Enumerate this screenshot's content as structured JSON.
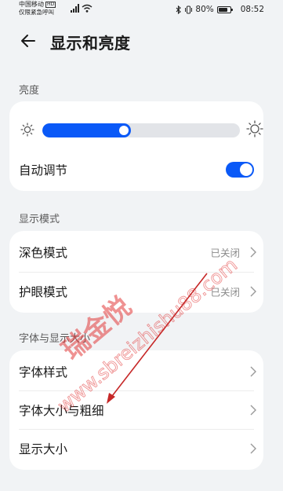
{
  "status_bar": {
    "carrier": "中国移动",
    "carrier_badge": "HD",
    "emergency": "仅限紧急呼叫",
    "battery": "80%",
    "battery_level": 0.8,
    "time": "08:52"
  },
  "header": {
    "title": "显示和亮度"
  },
  "brightness": {
    "section_label": "亮度",
    "level": 0.45,
    "auto_label": "自动调节",
    "auto_on": true
  },
  "display_mode": {
    "section_label": "显示模式",
    "items": [
      {
        "label": "深色模式",
        "value": "已关闭"
      },
      {
        "label": "护眼模式",
        "value": "已关闭"
      }
    ]
  },
  "font_display": {
    "section_label": "字体与显示大小",
    "items": [
      {
        "label": "字体样式"
      },
      {
        "label": "字体大小与粗细"
      },
      {
        "label": "显示大小"
      }
    ]
  },
  "watermark": {
    "text_cn": "瑞金悦",
    "text_url": "www.sbreizhishu88.com",
    "color": "#e23a3a"
  },
  "colors": {
    "accent": "#0a59f7",
    "annotation_arrow": "#c62828"
  }
}
